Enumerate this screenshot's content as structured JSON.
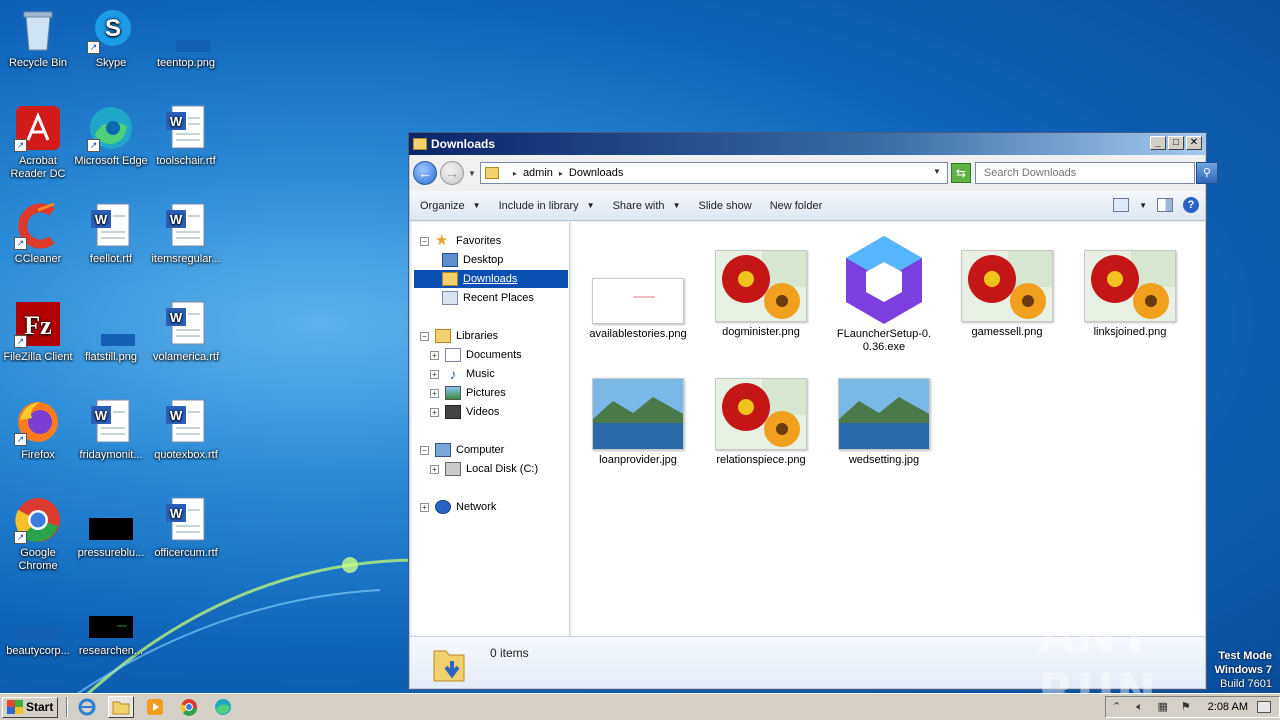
{
  "desktop": {
    "icons": [
      {
        "label": "Recycle Bin"
      },
      {
        "label": "Skype"
      },
      {
        "label": "teentop.png"
      },
      {
        "label": "Acrobat Reader DC"
      },
      {
        "label": "Microsoft Edge"
      },
      {
        "label": "toolschair.rtf"
      },
      {
        "label": "CCleaner"
      },
      {
        "label": "feellot.rtf"
      },
      {
        "label": "itemsregular..."
      },
      {
        "label": "FileZilla Client"
      },
      {
        "label": "flatstill.png"
      },
      {
        "label": "volamerica.rtf"
      },
      {
        "label": "Firefox"
      },
      {
        "label": "fridaymonit..."
      },
      {
        "label": "quotexbox.rtf"
      },
      {
        "label": "Google Chrome"
      },
      {
        "label": "pressureblu..."
      },
      {
        "label": "officercum.rtf"
      },
      {
        "label": "beautycorp..."
      },
      {
        "label": "researchen..."
      }
    ]
  },
  "window": {
    "title": "Downloads",
    "address": {
      "crumb1": "admin",
      "crumb2": "Downloads"
    },
    "search": {
      "placeholder": "Search Downloads"
    },
    "toolbar": {
      "organize": "Organize",
      "include": "Include in library",
      "share": "Share with",
      "slideshow": "Slide show",
      "newfolder": "New folder"
    },
    "nav": {
      "favorites": "Favorites",
      "desktop": "Desktop",
      "downloads": "Downloads",
      "recent": "Recent Places",
      "libraries": "Libraries",
      "documents": "Documents",
      "music": "Music",
      "pictures": "Pictures",
      "videos": "Videos",
      "computer": "Computer",
      "localdisk": "Local Disk (C:)",
      "network": "Network"
    },
    "files": [
      {
        "name": "availablestories.png"
      },
      {
        "name": "dogminister.png"
      },
      {
        "name": "FLauncherSetup-0.0.36.exe"
      },
      {
        "name": "gamessell.png"
      },
      {
        "name": "linksjoined.png"
      },
      {
        "name": "loanprovider.jpg"
      },
      {
        "name": "relationspiece.png"
      },
      {
        "name": "wedsetting.jpg"
      }
    ],
    "status": {
      "count": "0 items"
    }
  },
  "taskbar": {
    "start": "Start",
    "clock": "2:08 AM"
  },
  "watermark": {
    "line1": "Test Mode",
    "line2": "Windows 7",
    "line3": "Build 7601",
    "brand": "ANY RUN"
  },
  "colors": {
    "desktop_blue": "#1a6fc6",
    "selection": "#0b4fb3",
    "titlebar": "#0a246a"
  }
}
